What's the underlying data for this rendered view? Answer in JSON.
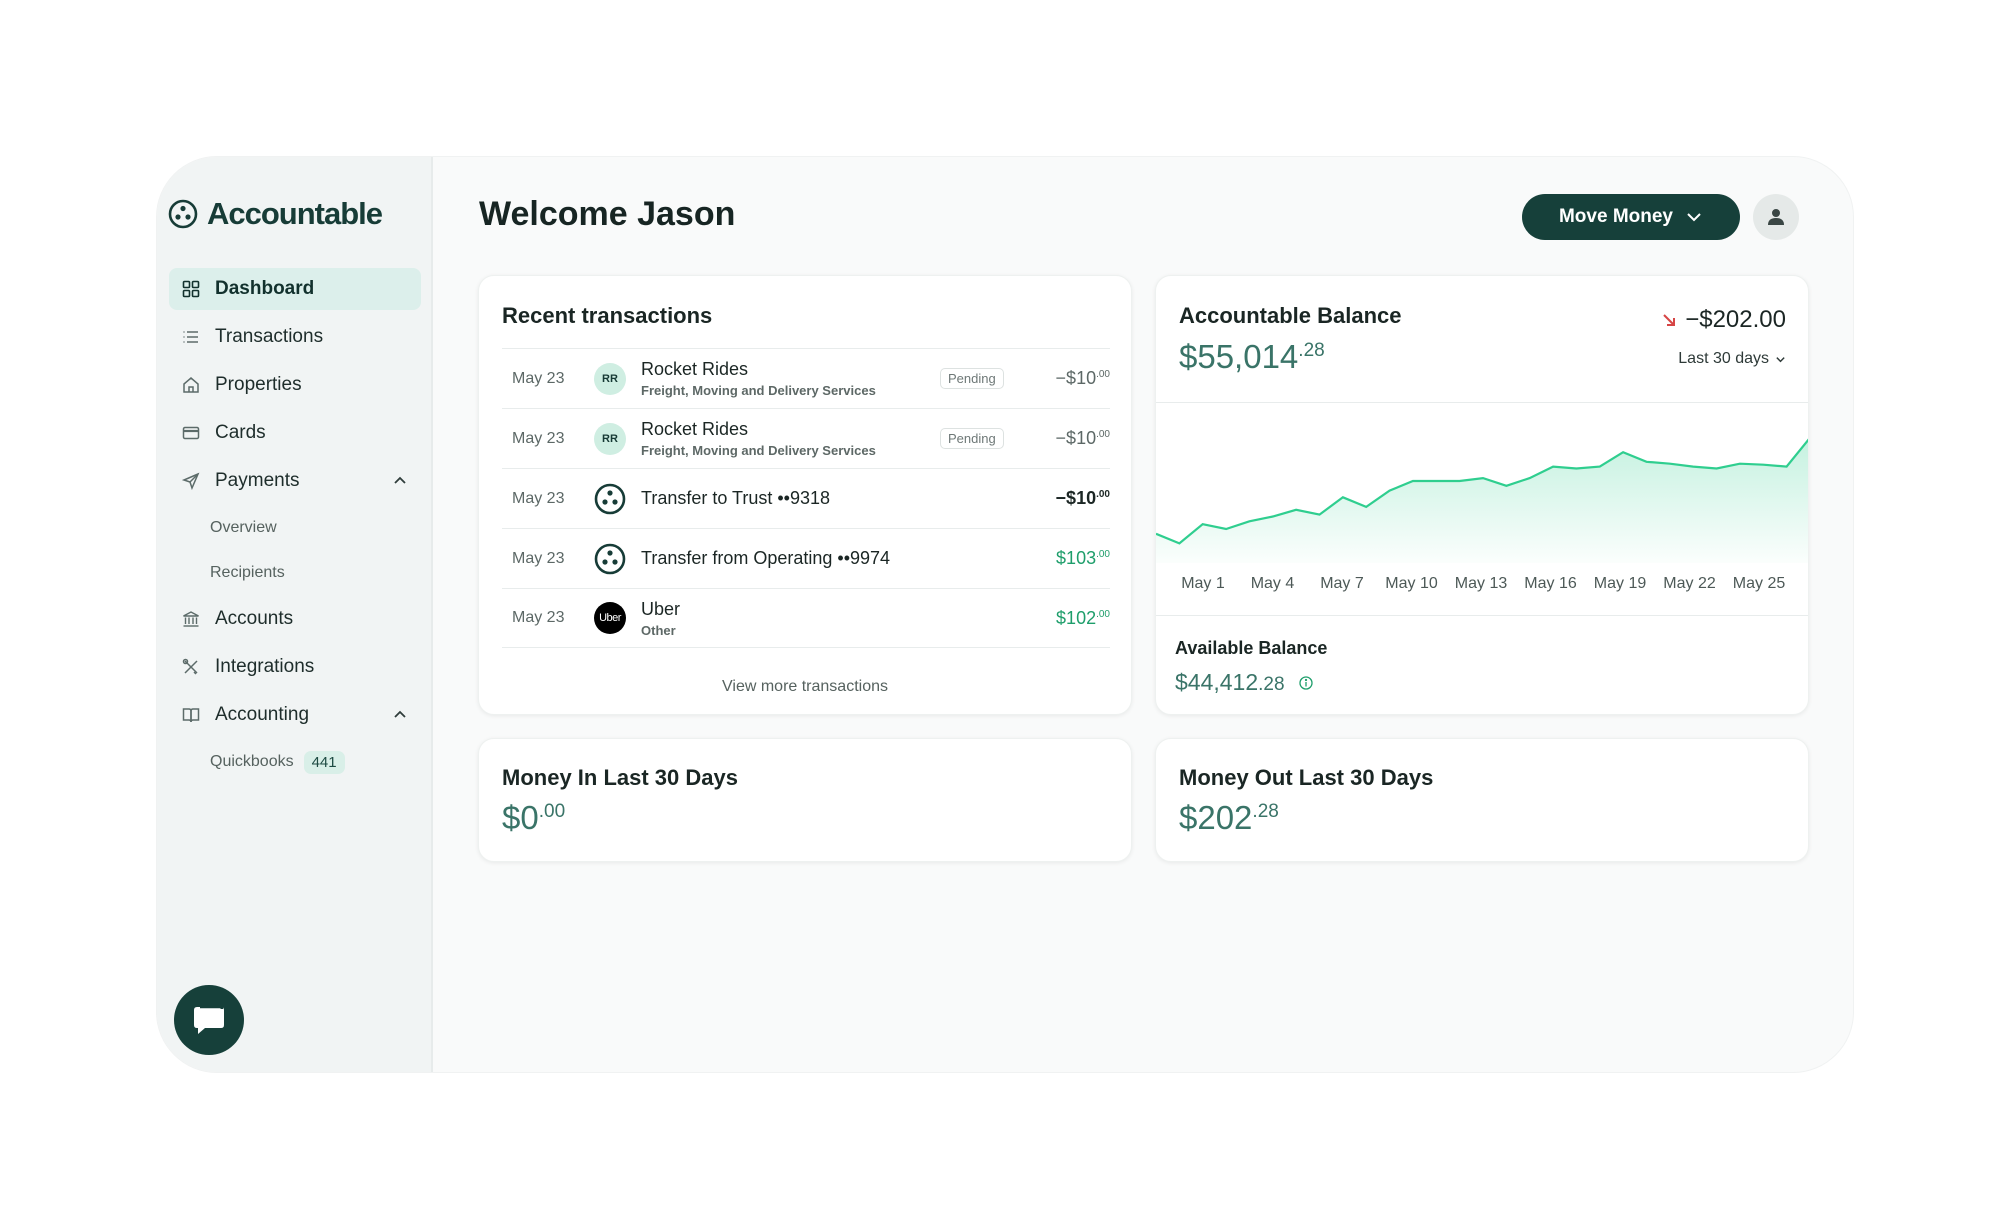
{
  "brand": {
    "name": "Accountable"
  },
  "sidebar": {
    "items": [
      {
        "label": "Dashboard",
        "icon": "grid-icon"
      },
      {
        "label": "Transactions",
        "icon": "list-icon"
      },
      {
        "label": "Properties",
        "icon": "home-icon"
      },
      {
        "label": "Cards",
        "icon": "card-icon"
      },
      {
        "label": "Payments",
        "icon": "send-icon"
      },
      {
        "label": "Accounts",
        "icon": "bank-icon"
      },
      {
        "label": "Integrations",
        "icon": "tools-icon"
      },
      {
        "label": "Accounting",
        "icon": "book-icon"
      }
    ],
    "payments_sub": [
      "Overview",
      "Recipients"
    ],
    "accounting_sub": {
      "label": "Quickbooks",
      "badge": "441"
    }
  },
  "header": {
    "welcome": "Welcome Jason",
    "move_money": "Move Money"
  },
  "transactions": {
    "title": "Recent transactions",
    "rows": [
      {
        "date": "May 23",
        "logo": "RR",
        "name": "Rocket Rides",
        "category": "Freight, Moving and Delivery Services",
        "status": "Pending",
        "amount": "−$10",
        "cents": ".00"
      },
      {
        "date": "May 23",
        "logo": "RR",
        "name": "Rocket Rides",
        "category": "Freight, Moving and Delivery Services",
        "status": "Pending",
        "amount": "−$10",
        "cents": ".00"
      },
      {
        "date": "May 23",
        "logo": "",
        "name": "Transfer to Trust ••9318",
        "category": "",
        "status": "",
        "amount": "−$10",
        "cents": ".00"
      },
      {
        "date": "May 23",
        "logo": "",
        "name": "Transfer from Operating ••9974",
        "category": "",
        "status": "",
        "amount": "$103",
        "cents": ".00"
      },
      {
        "date": "May 23",
        "logo": "Uber",
        "name": "Uber",
        "category": "Other",
        "status": "",
        "amount": "$102",
        "cents": ".00"
      }
    ],
    "view_more": "View more transactions"
  },
  "balance": {
    "title": "Accountable Balance",
    "amount": "$55,014",
    "cents": ".28",
    "change": "−$202.00",
    "range": "Last 30 days",
    "available_label": "Available Balance",
    "available_amount": "$44,412",
    "available_cents": ".28"
  },
  "chart_data": {
    "type": "area",
    "x_ticks": [
      "May 1",
      "May 4",
      "May 7",
      "May 10",
      "May 13",
      "May 16",
      "May 19",
      "May 22",
      "May 25"
    ],
    "values": [
      0.2,
      0.1,
      0.3,
      0.25,
      0.33,
      0.38,
      0.45,
      0.4,
      0.58,
      0.48,
      0.65,
      0.75,
      0.75,
      0.75,
      0.78,
      0.7,
      0.78,
      0.9,
      0.88,
      0.9,
      1.05,
      0.95,
      0.93,
      0.9,
      0.88,
      0.93,
      0.92,
      0.9,
      1.2
    ],
    "color": "#2fce8f",
    "grid": false
  },
  "money_in": {
    "title": "Money In Last 30 Days",
    "amount": "$0",
    "cents": ".00"
  },
  "money_out": {
    "title": "Money Out Last 30 Days",
    "amount": "$202",
    "cents": ".28"
  },
  "colors": {
    "brand": "#16403a",
    "positive": "#1e9e6b",
    "negative_arrow": "#d64545",
    "active_nav": "#dcefeb"
  }
}
